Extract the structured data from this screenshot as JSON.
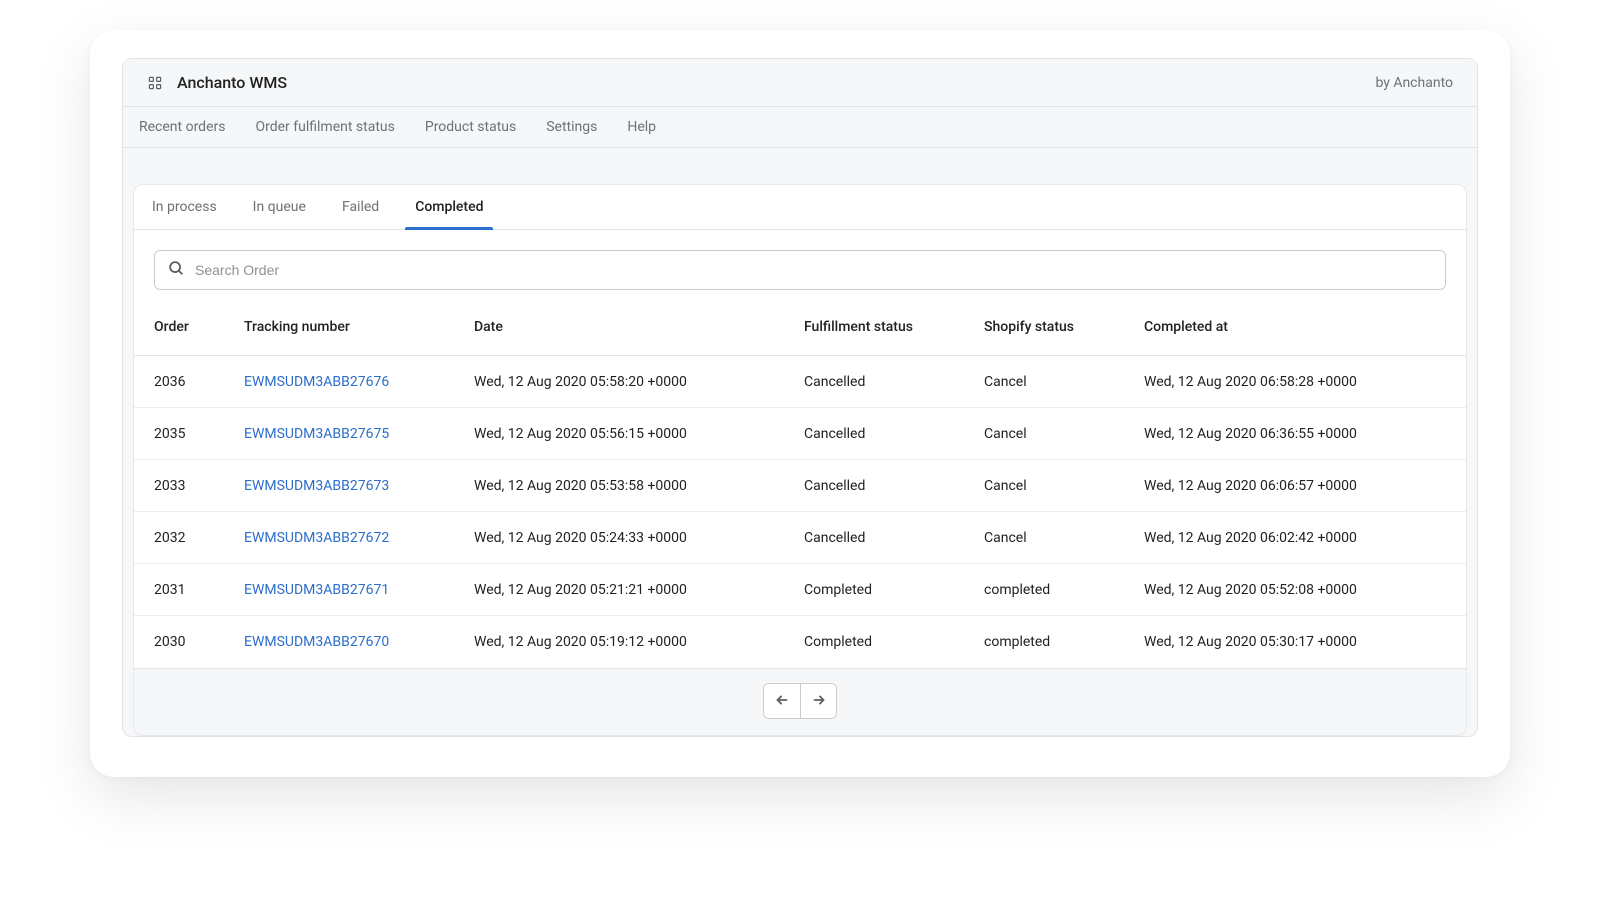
{
  "header": {
    "title": "Anchanto WMS",
    "byline": "by Anchanto"
  },
  "nav": {
    "items": [
      {
        "label": "Recent orders"
      },
      {
        "label": "Order fulfilment status"
      },
      {
        "label": "Product status"
      },
      {
        "label": "Settings"
      },
      {
        "label": "Help"
      }
    ]
  },
  "tabs": {
    "items": [
      {
        "label": "In process",
        "active": false
      },
      {
        "label": "In queue",
        "active": false
      },
      {
        "label": "Failed",
        "active": false
      },
      {
        "label": "Completed",
        "active": true
      }
    ]
  },
  "search": {
    "placeholder": "Search Order",
    "value": ""
  },
  "table": {
    "columns": [
      {
        "label": "Order"
      },
      {
        "label": "Tracking number"
      },
      {
        "label": "Date"
      },
      {
        "label": "Fulfillment status"
      },
      {
        "label": "Shopify status"
      },
      {
        "label": "Completed at"
      }
    ],
    "rows": [
      {
        "order": "2036",
        "tracking": "EWMSUDM3ABB27676",
        "date": "Wed, 12 Aug 2020 05:58:20 +0000",
        "fulfillment": "Cancelled",
        "shopify": "Cancel",
        "completed": "Wed, 12 Aug 2020 06:58:28 +0000"
      },
      {
        "order": "2035",
        "tracking": "EWMSUDM3ABB27675",
        "date": "Wed, 12 Aug 2020 05:56:15 +0000",
        "fulfillment": "Cancelled",
        "shopify": "Cancel",
        "completed": "Wed, 12 Aug 2020 06:36:55 +0000"
      },
      {
        "order": "2033",
        "tracking": "EWMSUDM3ABB27673",
        "date": "Wed, 12 Aug 2020 05:53:58 +0000",
        "fulfillment": "Cancelled",
        "shopify": "Cancel",
        "completed": "Wed, 12 Aug 2020 06:06:57 +0000"
      },
      {
        "order": "2032",
        "tracking": "EWMSUDM3ABB27672",
        "date": "Wed, 12 Aug 2020 05:24:33 +0000",
        "fulfillment": "Cancelled",
        "shopify": "Cancel",
        "completed": "Wed, 12 Aug 2020 06:02:42 +0000"
      },
      {
        "order": "2031",
        "tracking": "EWMSUDM3ABB27671",
        "date": "Wed, 12 Aug 2020 05:21:21 +0000",
        "fulfillment": "Completed",
        "shopify": "completed",
        "completed": "Wed, 12 Aug 2020 05:52:08 +0000"
      },
      {
        "order": "2030",
        "tracking": "EWMSUDM3ABB27670",
        "date": "Wed, 12 Aug 2020 05:19:12 +0000",
        "fulfillment": "Completed",
        "shopify": "completed",
        "completed": "Wed, 12 Aug 2020 05:30:17 +0000"
      }
    ]
  }
}
